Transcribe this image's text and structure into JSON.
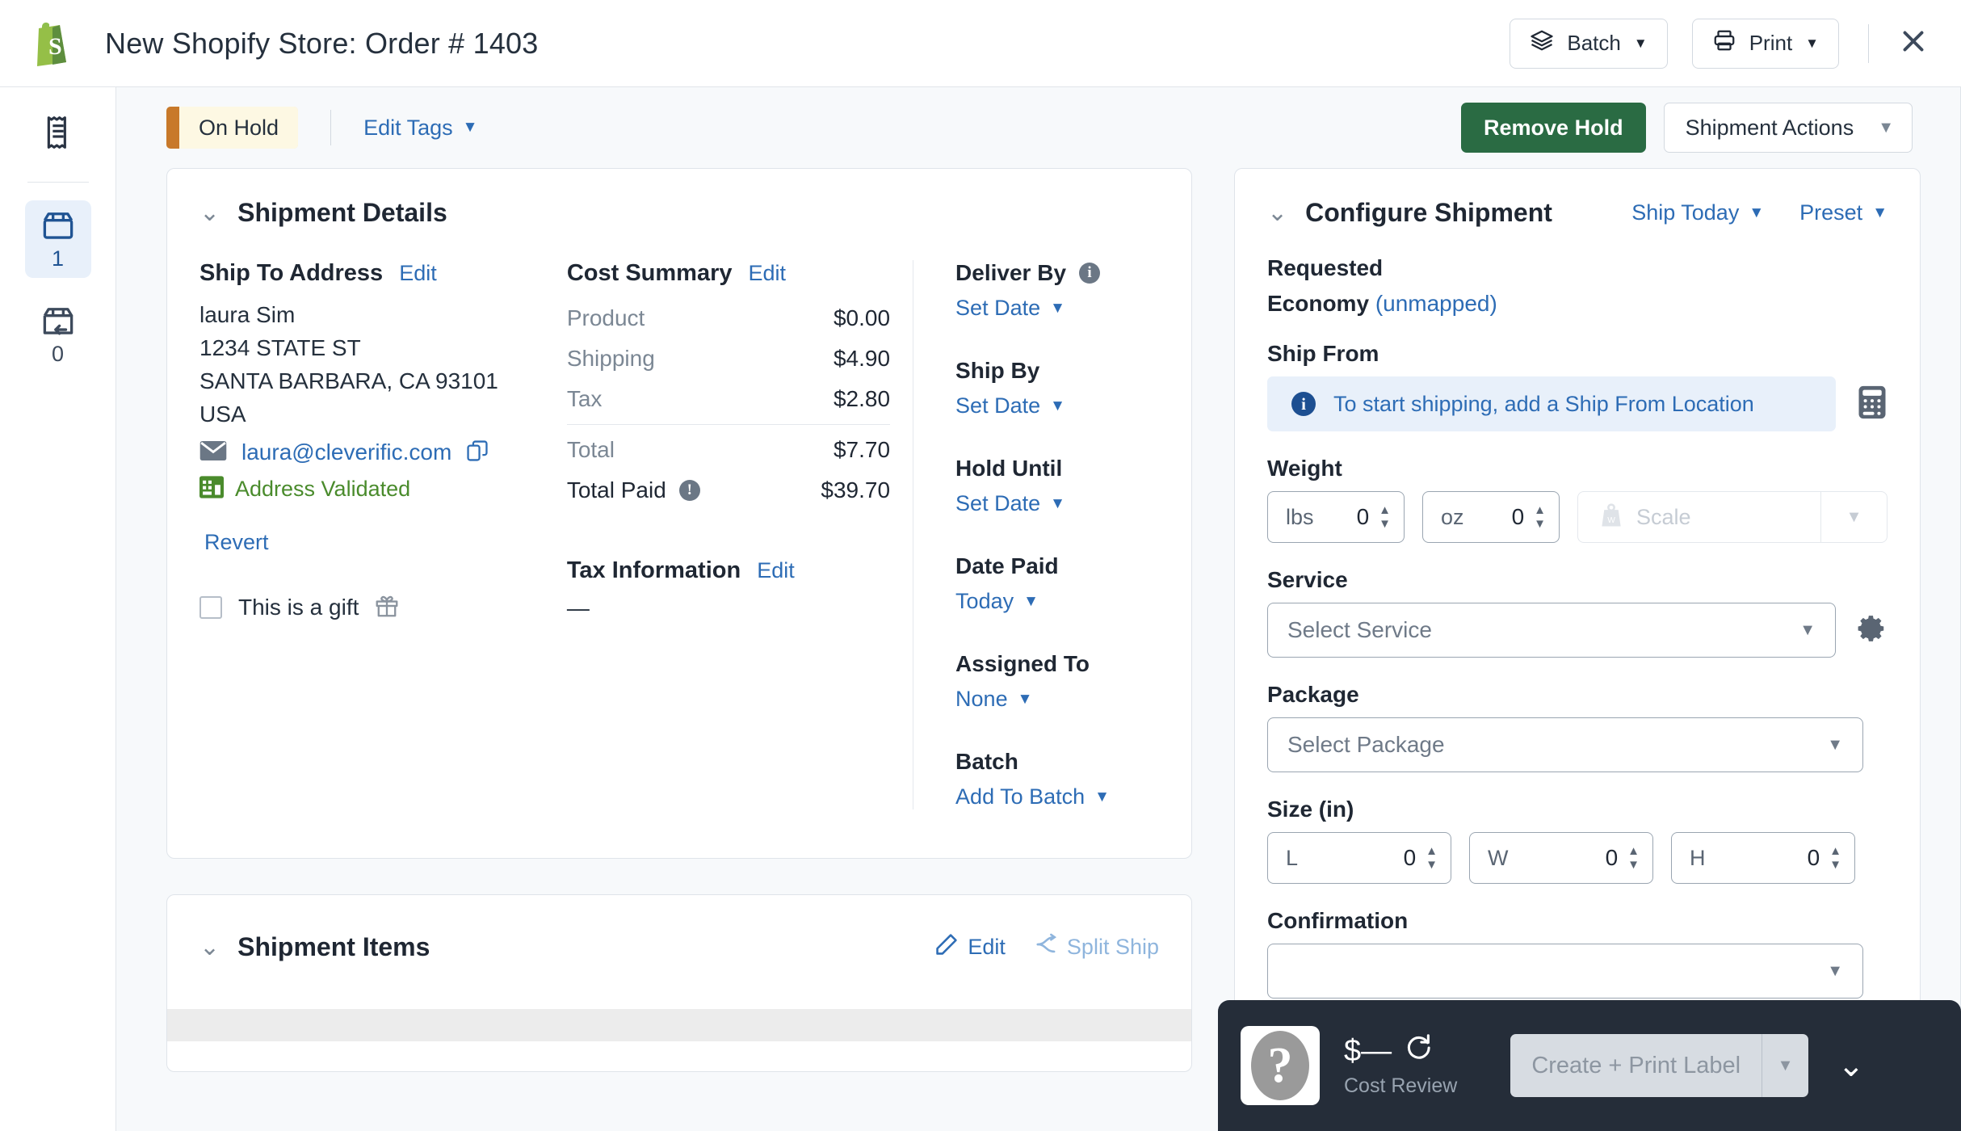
{
  "topbar": {
    "logo_icon": "shopify-bag-icon",
    "title": "New Shopify Store:  Order # 1403",
    "batch_label": "Batch",
    "batch_icon": "layers-icon",
    "print_label": "Print",
    "print_icon": "printer-icon",
    "close_icon": "close-icon"
  },
  "rail": {
    "items": [
      {
        "icon": "receipt-icon",
        "count": "",
        "active": false
      },
      {
        "icon": "package-icon",
        "count": "1",
        "active": true
      },
      {
        "icon": "package-return-icon",
        "count": "0",
        "active": false
      }
    ]
  },
  "subheader": {
    "status": "On Hold",
    "status_color": "#c8792a",
    "edit_tags": "Edit Tags",
    "remove_hold": "Remove Hold",
    "remove_hold_color": "#2a6b43",
    "shipment_actions": "Shipment Actions"
  },
  "shipment_details": {
    "title": "Shipment Details",
    "ship_to": {
      "heading": "Ship To Address",
      "edit": "Edit",
      "name": "laura Sim",
      "street": "1234 STATE ST",
      "city_state_zip": "SANTA BARBARA, CA 93101",
      "country": "USA",
      "email": "laura@cleverific.com",
      "email_icon": "envelope-icon",
      "copy_icon": "copy-icon",
      "validated": "Address Validated",
      "validated_icon": "building-icon",
      "validated_color": "#4a8b2c",
      "revert": "Revert",
      "gift_label": "This is a gift",
      "gift_icon": "gift-icon",
      "gift_checked": false
    },
    "cost_summary": {
      "heading": "Cost Summary",
      "edit": "Edit",
      "rows": [
        {
          "label": "Product",
          "value": "$0.00"
        },
        {
          "label": "Shipping",
          "value": "$4.90"
        },
        {
          "label": "Tax",
          "value": "$2.80"
        }
      ],
      "total_label": "Total",
      "total_value": "$7.70",
      "total_paid_label": "Total Paid",
      "total_paid_value": "$39.70",
      "total_paid_icon": "info-icon"
    },
    "tax_information": {
      "heading": "Tax Information",
      "edit": "Edit",
      "value": "—"
    },
    "dates": [
      {
        "label": "Deliver By",
        "icon": "info-icon",
        "value": "Set Date"
      },
      {
        "label": "Ship By",
        "icon": "",
        "value": "Set Date"
      },
      {
        "label": "Hold Until",
        "icon": "",
        "value": "Set Date"
      },
      {
        "label": "Date Paid",
        "icon": "",
        "value": "Today"
      },
      {
        "label": "Assigned To",
        "icon": "",
        "value": "None"
      },
      {
        "label": "Batch",
        "icon": "",
        "value": "Add To Batch"
      }
    ]
  },
  "shipment_items": {
    "title": "Shipment Items",
    "edit": "Edit",
    "edit_icon": "pencil-icon",
    "split_ship": "Split Ship",
    "split_ship_icon": "split-icon"
  },
  "configure_shipment": {
    "title": "Configure Shipment",
    "ship_today": "Ship Today",
    "preset": "Preset",
    "requested_label": "Requested",
    "requested_service": "Economy",
    "requested_mapping": "(unmapped)",
    "ship_from_label": "Ship From",
    "ship_from_notice": "To start shipping, add a Ship From Location",
    "ship_from_icon": "info-icon",
    "calculator_icon": "calculator-icon",
    "weight_label": "Weight",
    "weight_lbs_unit": "lbs",
    "weight_lbs_value": "0",
    "weight_oz_unit": "oz",
    "weight_oz_value": "0",
    "scale_label": "Scale",
    "scale_icon": "weight-icon",
    "service_label": "Service",
    "service_placeholder": "Select Service",
    "service_gear_icon": "gear-icon",
    "package_label": "Package",
    "package_placeholder": "Select Package",
    "size_label": "Size (in)",
    "size_fields": [
      {
        "unit": "L",
        "value": "0"
      },
      {
        "unit": "W",
        "value": "0"
      },
      {
        "unit": "H",
        "value": "0"
      }
    ],
    "confirmation_label": "Confirmation",
    "confirmation_value": ""
  },
  "bottombar": {
    "help_icon": "help-question-icon",
    "cost_amount": "$—",
    "refresh_icon": "refresh-icon",
    "cost_review_label": "Cost Review",
    "create_print_label": "Create + Print Label",
    "collapse_icon": "chevron-down-icon"
  }
}
